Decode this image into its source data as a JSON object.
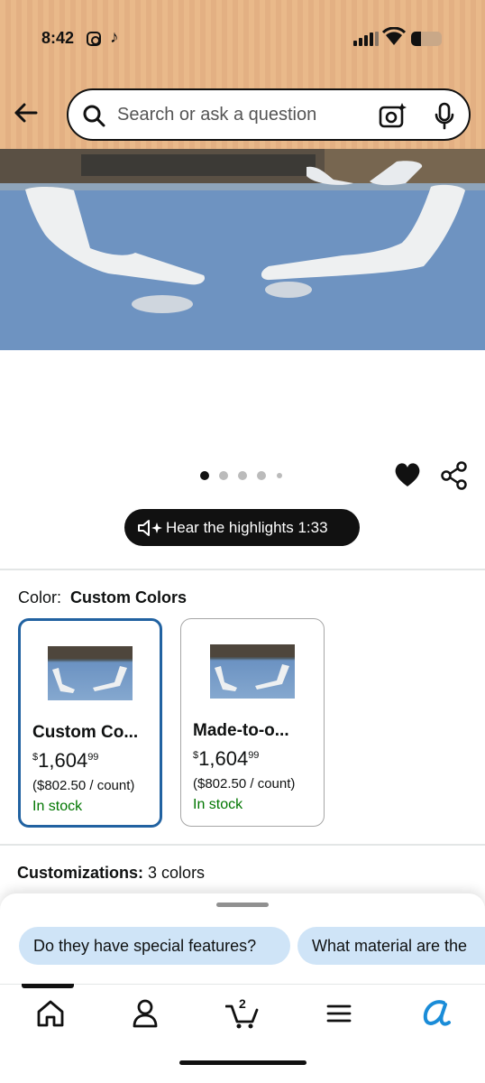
{
  "status_bar": {
    "time": "8:42",
    "icons": [
      "instagram-icon",
      "tiktok-icon",
      "signal-icon",
      "wifi-icon",
      "battery-icon"
    ]
  },
  "header": {
    "back_icon": "arrow-left-icon",
    "search": {
      "placeholder": "Search or ask a question",
      "icons": [
        "search-icon",
        "camera-sparkle-icon",
        "microphone-icon"
      ]
    },
    "background_color": "#e9b98a"
  },
  "gallery": {
    "image_count": 5,
    "active_index": 0,
    "wishlist_icon": "heart-icon",
    "share_icon": "share-icon"
  },
  "audio_summary": {
    "label": "Hear the highlights 1:33",
    "icon": "speaker-sparkle-icon"
  },
  "color_selector": {
    "label": "Color:",
    "value": "Custom Colors",
    "selected_border_color": "#2162a1",
    "options": [
      {
        "title": "Custom Co...",
        "price_symbol": "$",
        "price_whole": "1,604",
        "price_fraction": "99",
        "unit_price": "($802.50 / count)",
        "availability": "In stock",
        "selected": true
      },
      {
        "title": "Made-to-o...",
        "price_symbol": "$",
        "price_whole": "1,604",
        "price_fraction": "99",
        "unit_price": "($802.50 / count)",
        "availability": "In stock",
        "selected": false
      }
    ]
  },
  "customizations": {
    "label": "Customizations:",
    "value": "3 colors"
  },
  "suggestions": {
    "chips": [
      "Do they have special features?",
      "What material are the"
    ],
    "chip_color": "#cfe4f7"
  },
  "bottom_nav": {
    "items": [
      "home-icon",
      "account-icon",
      "cart-icon",
      "menu-icon",
      "rufus-icon"
    ],
    "cart_count": "2",
    "accent_color": "#1a8cd8"
  }
}
